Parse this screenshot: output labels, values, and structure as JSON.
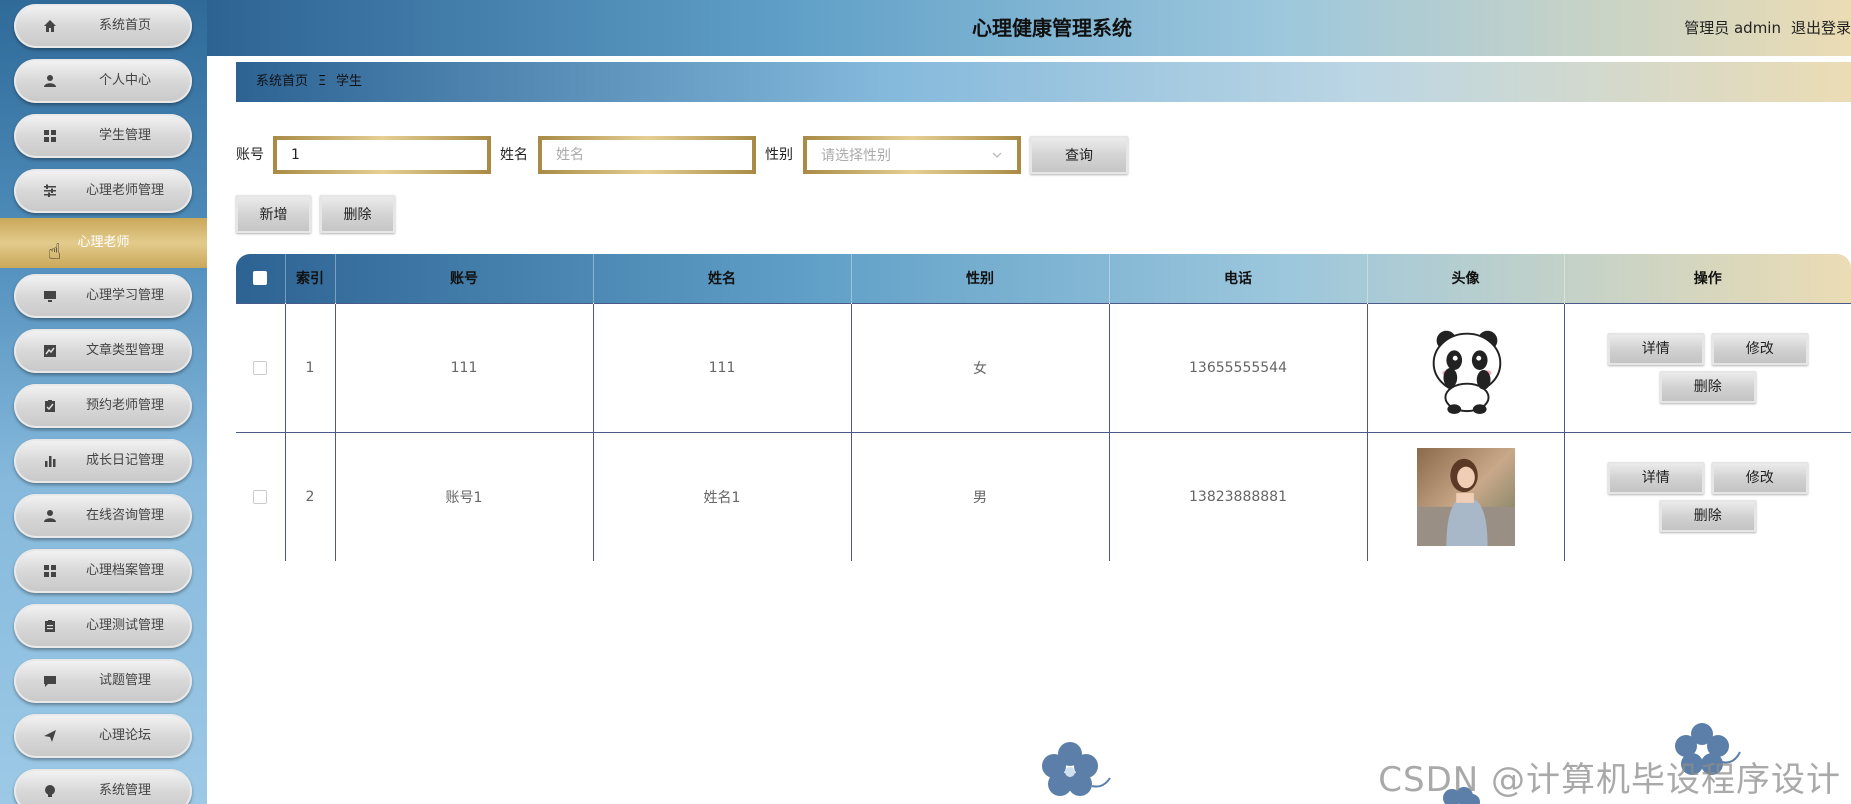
{
  "header": {
    "title": "心理健康管理系统",
    "user": "管理员 admin",
    "logout": "退出登录"
  },
  "sidebar": {
    "items": [
      {
        "label": "系统首页",
        "icon": "home-icon"
      },
      {
        "label": "个人中心",
        "icon": "user-icon"
      },
      {
        "label": "学生管理",
        "icon": "grid-icon"
      },
      {
        "label": "心理老师管理",
        "icon": "sliders-icon"
      },
      {
        "label": "心理学习管理",
        "icon": "monitor-icon"
      },
      {
        "label": "文章类型管理",
        "icon": "chart-icon"
      },
      {
        "label": "预约老师管理",
        "icon": "clipboard-check-icon"
      },
      {
        "label": "成长日记管理",
        "icon": "bar-chart-icon"
      },
      {
        "label": "在线咨询管理",
        "icon": "user-icon"
      },
      {
        "label": "心理档案管理",
        "icon": "grid-icon"
      },
      {
        "label": "心理测试管理",
        "icon": "clipboard-icon"
      },
      {
        "label": "试题管理",
        "icon": "message-icon"
      },
      {
        "label": "心理论坛",
        "icon": "send-icon"
      },
      {
        "label": "系统管理",
        "icon": "bulb-icon"
      }
    ],
    "active_submenu": "心理老师"
  },
  "breadcrumb": {
    "home": "系统首页",
    "separator": "Ξ",
    "current": "学生"
  },
  "search": {
    "account_label": "账号",
    "account_value": "1",
    "name_label": "姓名",
    "name_placeholder": "姓名",
    "gender_label": "性别",
    "gender_placeholder": "请选择性别",
    "query_button": "查询"
  },
  "actions": {
    "add": "新增",
    "delete": "删除"
  },
  "table": {
    "headers": [
      "索引",
      "账号",
      "姓名",
      "性别",
      "电话",
      "头像",
      "操作"
    ],
    "rows": [
      {
        "index": "1",
        "account": "111",
        "name": "111",
        "gender": "女",
        "phone": "13655555544",
        "avatar": "panda-avatar"
      },
      {
        "index": "2",
        "account": "账号1",
        "name": "姓名1",
        "gender": "男",
        "phone": "13823888881",
        "avatar": "photo-avatar"
      }
    ],
    "row_actions": {
      "detail": "详情",
      "edit": "修改",
      "delete": "删除"
    }
  },
  "watermark": "CSDN @计算机毕设程序设计",
  "colors": {
    "header_start": "#2d6393",
    "header_end": "#ebdcb4",
    "submenu_gold": "#c9a85a",
    "flower": "#5b7fa8"
  }
}
